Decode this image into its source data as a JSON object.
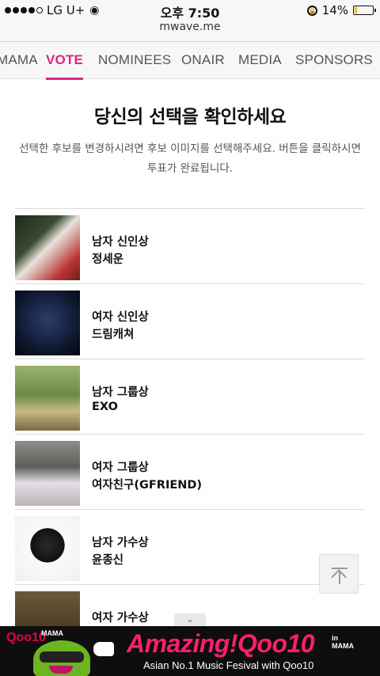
{
  "status": {
    "carrier": "LG U+",
    "time": "오후 7:50",
    "battery": "14%",
    "url": "mwave.me"
  },
  "nav": {
    "tabs": [
      {
        "label": "MAMA"
      },
      {
        "label": "VOTE",
        "active": true
      },
      {
        "label": "NOMINEES"
      },
      {
        "label": "ONAIR"
      },
      {
        "label": "MEDIA"
      },
      {
        "label": "SPONSORS"
      }
    ]
  },
  "page": {
    "title": "당신의 선택을 확인하세요",
    "description": "선택한 후보를 변경하시려면 후보 이미지를 선택해주세요. 버튼을 클릭하시면 투표가 완료됩니다."
  },
  "nominees": [
    {
      "category": "남자 신인상",
      "name": "정세운"
    },
    {
      "category": "여자 신인상",
      "name": "드림캐쳐"
    },
    {
      "category": "남자 그룹상",
      "name": "EXO"
    },
    {
      "category": "여자 그룹상",
      "name": "여자친구(GFRIEND)"
    },
    {
      "category": "남자 가수상",
      "name": "윤종신"
    },
    {
      "category": "여자 가수상",
      "name": ""
    }
  ],
  "ad": {
    "brand": "Qoo10",
    "mama_logo": "MAMA",
    "headline": "Amazing!Qoo10",
    "in_label": "in",
    "mama_label": "MAMA",
    "tagline": "Asian No.1 Music Fesival with Qoo10"
  },
  "colors": {
    "accent": "#e0267f",
    "ad_headline": "#ff1e6e"
  }
}
